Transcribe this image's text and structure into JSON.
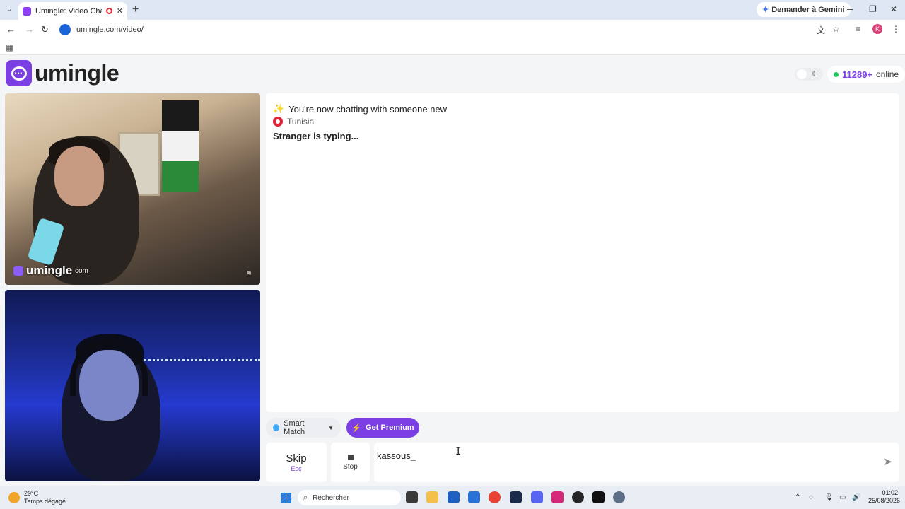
{
  "browser": {
    "tab_title": "Umingle: Video Chat with S",
    "new_tab": "+",
    "gemini_label": "Demander à Gemini",
    "url": "umingle.com/video/",
    "profile_initial": "K"
  },
  "site": {
    "logo_text": "umingle",
    "online_count": "11289+",
    "online_label": "online",
    "watermark_name": "umingle",
    "watermark_tld": ".com"
  },
  "chat": {
    "status": "You're now chatting with someone new",
    "country": "Tunisia",
    "typing": "Stranger is typing..."
  },
  "controls": {
    "smart_match": "Smart Match",
    "premium": "Get Premium",
    "skip": "Skip",
    "skip_key": "Esc",
    "stop": "Stop",
    "message_value": "kassous_"
  },
  "taskbar": {
    "temp": "29°C",
    "weather": "Temps dégagé",
    "search": "Rechercher",
    "time": "01:02",
    "date": "25/08/2026"
  },
  "colors": {
    "brand": "#7b3fe4",
    "online_dot": "#22c55e"
  }
}
